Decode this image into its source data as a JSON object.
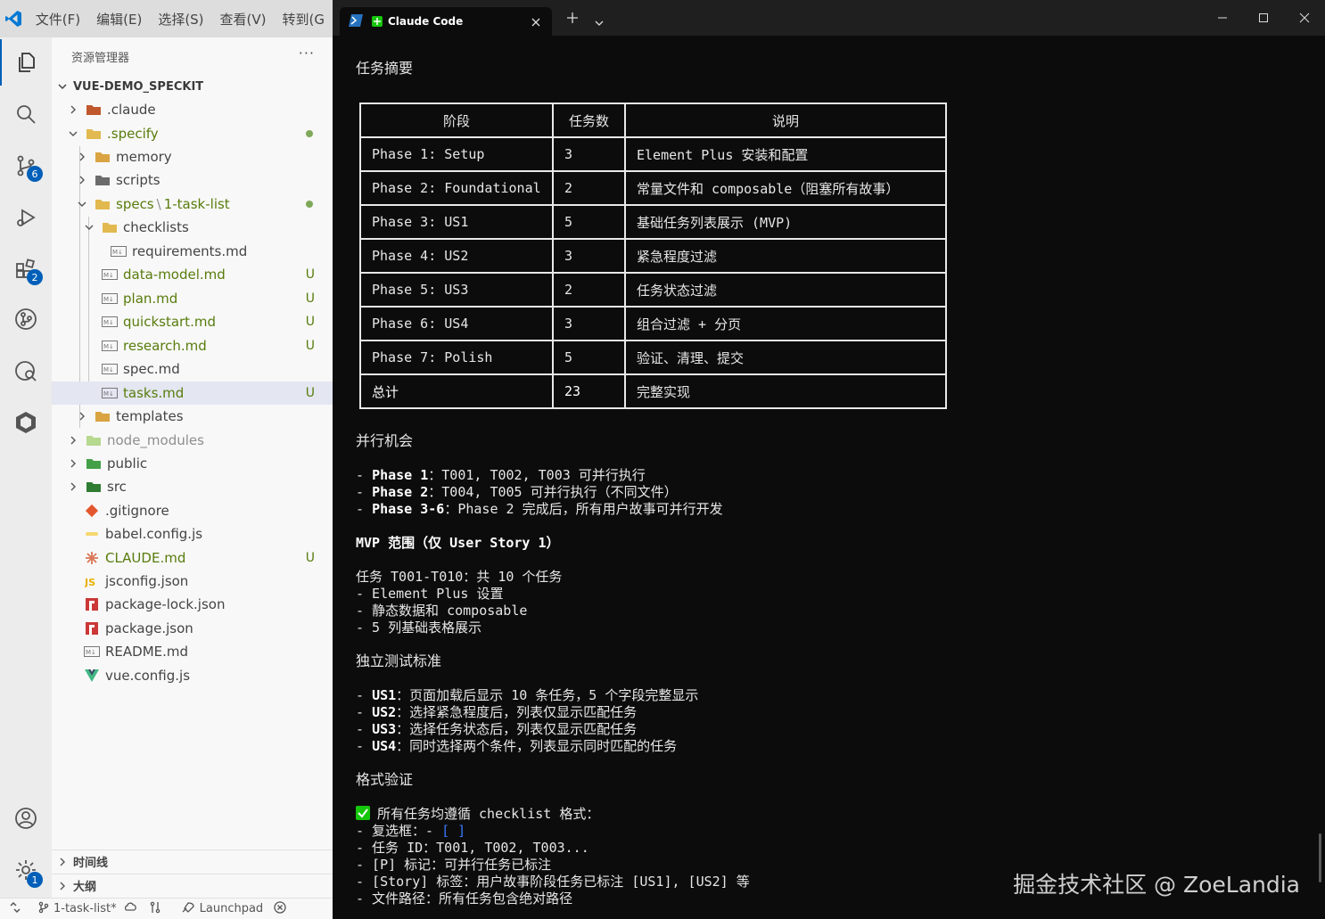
{
  "vscode": {
    "menu": [
      "文件(F)",
      "编辑(E)",
      "选择(S)",
      "查看(V)",
      "转到(G"
    ],
    "activity_badges": {
      "source_control": "6",
      "extensions": "2",
      "settings": "1"
    },
    "explorer_title": "资源管理器",
    "more_label": "···",
    "root_folder": "VUE-DEMO_SPECKIT",
    "tree": [
      {
        "label": ".claude"
      },
      {
        "label": ".specify"
      },
      {
        "label": "memory"
      },
      {
        "label": "scripts"
      },
      {
        "label": "specs",
        "label2": "1-task-list"
      },
      {
        "label": "checklists"
      },
      {
        "label": "requirements.md"
      },
      {
        "label": "data-model.md",
        "status": "U"
      },
      {
        "label": "plan.md",
        "status": "U"
      },
      {
        "label": "quickstart.md",
        "status": "U"
      },
      {
        "label": "research.md",
        "status": "U"
      },
      {
        "label": "spec.md"
      },
      {
        "label": "tasks.md",
        "status": "U"
      },
      {
        "label": "templates"
      },
      {
        "label": "node_modules"
      },
      {
        "label": "public"
      },
      {
        "label": "src"
      },
      {
        "label": ".gitignore"
      },
      {
        "label": "babel.config.js"
      },
      {
        "label": "CLAUDE.md",
        "status": "U"
      },
      {
        "label": "jsconfig.json"
      },
      {
        "label": "package-lock.json"
      },
      {
        "label": "package.json"
      },
      {
        "label": "README.md"
      },
      {
        "label": "vue.config.js"
      }
    ],
    "timeline_label": "时间线",
    "outline_label": "大纲",
    "status": {
      "branch": "1-task-list*",
      "launchpad": "Launchpad"
    }
  },
  "terminal": {
    "tab_title": "Claude Code",
    "summary_heading": "任务摘要",
    "table": {
      "headers": [
        "阶段",
        "任务数",
        "说明"
      ],
      "rows": [
        [
          "Phase 1: Setup",
          "3",
          "Element Plus 安装和配置"
        ],
        [
          "Phase 2: Foundational",
          "2",
          "常量文件和 composable（阻塞所有故事）"
        ],
        [
          "Phase 3: US1",
          "5",
          "基础任务列表展示 (MVP)"
        ],
        [
          "Phase 4: US2",
          "3",
          "紧急程度过滤"
        ],
        [
          "Phase 5: US3",
          "2",
          "任务状态过滤"
        ],
        [
          "Phase 6: US4",
          "3",
          "组合过滤 + 分页"
        ],
        [
          "Phase 7: Polish",
          "5",
          "验证、清理、提交"
        ],
        [
          "总计",
          "23",
          "完整实现"
        ]
      ]
    },
    "parallel_heading": "并行机会",
    "parallel": [
      {
        "prefix": "- ",
        "key": "Phase 1",
        "text": "：T001, T002, T003 可并行执行"
      },
      {
        "prefix": "- ",
        "key": "Phase 2",
        "text": "：T004, T005 可并行执行（不同文件）"
      },
      {
        "prefix": "- ",
        "key": "Phase 3-6",
        "text": "：Phase 2 完成后，所有用户故事可并行开发"
      }
    ],
    "mvp_heading": "MVP 范围（仅 User Story 1）",
    "mvp_lines": [
      "任务 T001-T010：共 10 个任务",
      "- Element Plus 设置",
      "- 静态数据和 composable",
      "- 5 列基础表格展示"
    ],
    "test_heading": "独立测试标准",
    "tests": [
      {
        "prefix": "- ",
        "key": "US1",
        "text": "：页面加载后显示 10 条任务，5 个字段完整显示"
      },
      {
        "prefix": "- ",
        "key": "US2",
        "text": "：选择紧急程度后，列表仅显示匹配任务"
      },
      {
        "prefix": "- ",
        "key": "US3",
        "text": "：选择任务状态后，列表仅显示匹配任务"
      },
      {
        "prefix": "- ",
        "key": "US4",
        "text": "：同时选择两个条件，列表显示同时匹配的任务"
      }
    ],
    "format_heading": "格式验证",
    "format_check": "所有任务均遵循 checklist 格式：",
    "format_lines": [
      {
        "text": "- 复选框：- ",
        "accent": "[ ]"
      },
      {
        "text": "- 任务 ID：T001, T002, T003...",
        "accent": ""
      },
      {
        "text": "- [P] 标记：可并行任务已标注",
        "accent": ""
      },
      {
        "text": "- [Story] 标签：用户故事阶段任务已标注 [US1], [US2] 等",
        "accent": ""
      },
      {
        "text": "- 文件路径：所有任务包含绝对路径",
        "accent": ""
      }
    ],
    "watermark": "掘金技术社区 @ ZoeLandia"
  },
  "colors": {
    "accent": "#005fb8",
    "untracked": "#587c0c",
    "check": "#16c60c",
    "link_blue": "#3b78ff"
  }
}
